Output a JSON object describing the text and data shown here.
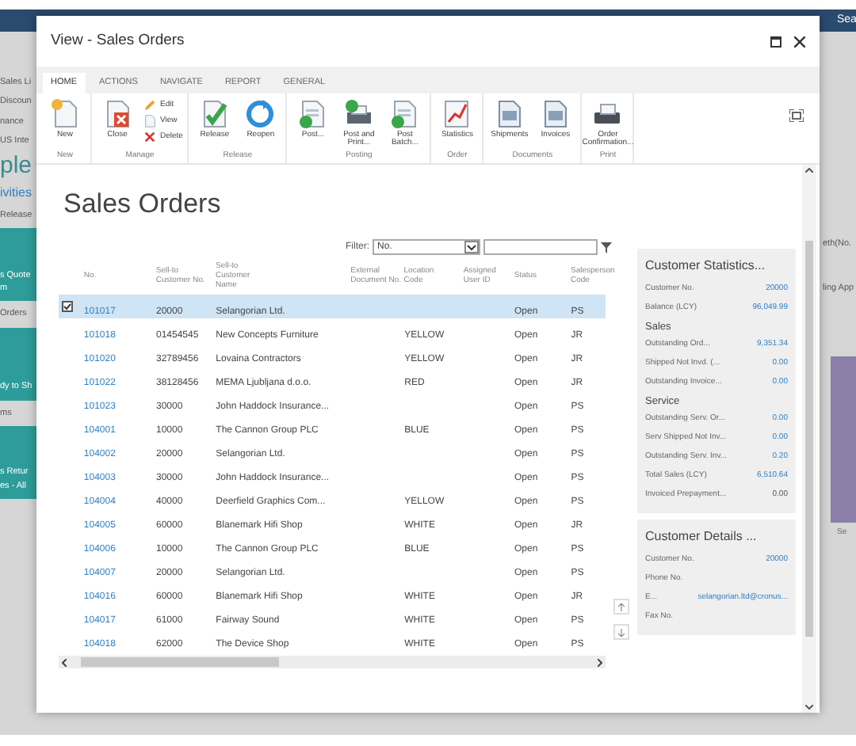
{
  "background": {
    "top_right": "Sea",
    "left": [
      {
        "kind": "label",
        "text": "Sales Li"
      },
      {
        "kind": "label",
        "text": "Discoun"
      },
      {
        "kind": "label",
        "text": "nance"
      },
      {
        "kind": "label",
        "text": "US Inte"
      },
      {
        "kind": "title",
        "text": "ple"
      },
      {
        "kind": "link",
        "text": "ivities"
      },
      {
        "kind": "label",
        "text": "Release"
      },
      {
        "kind": "tile",
        "text": "s Quote",
        "sub": "m"
      },
      {
        "kind": "label",
        "text": "Orders"
      },
      {
        "kind": "tile",
        "text": "dy to Sh"
      },
      {
        "kind": "label",
        "text": "ms"
      },
      {
        "kind": "tile",
        "text": "s Retur",
        "sub": "es - All"
      }
    ],
    "right": [
      "eth(No.",
      "ling App"
    ],
    "chart_label": "Se"
  },
  "window": {
    "title": "View - Sales Orders"
  },
  "tabs": [
    {
      "label": "HOME",
      "selected": true
    },
    {
      "label": "ACTIONS",
      "selected": false
    },
    {
      "label": "NAVIGATE",
      "selected": false
    },
    {
      "label": "REPORT",
      "selected": false
    },
    {
      "label": "GENERAL",
      "selected": false
    }
  ],
  "ribbon": [
    {
      "group": "New",
      "items": [
        {
          "label": "New",
          "kind": "new"
        }
      ]
    },
    {
      "group": "Manage",
      "items": [
        {
          "label": "Close",
          "kind": "close"
        }
      ],
      "small_items": [
        {
          "label": "Edit",
          "kind": "edit"
        },
        {
          "label": "View",
          "kind": "view"
        },
        {
          "label": "Delete",
          "kind": "delete"
        }
      ]
    },
    {
      "group": "Release",
      "items": [
        {
          "label": "Release",
          "kind": "release"
        },
        {
          "label": "Reopen",
          "kind": "reopen"
        }
      ]
    },
    {
      "group": "Posting",
      "items": [
        {
          "label": "Post...",
          "kind": "post"
        },
        {
          "label": "Post and Print...",
          "kind": "postprint"
        },
        {
          "label": "Post Batch...",
          "kind": "post"
        }
      ]
    },
    {
      "group": "Order",
      "items": [
        {
          "label": "Statistics",
          "kind": "chart"
        }
      ]
    },
    {
      "group": "Documents",
      "items": [
        {
          "label": "Shipments",
          "kind": "doc"
        },
        {
          "label": "Invoices",
          "kind": "doc"
        }
      ]
    },
    {
      "group": "Print",
      "items": [
        {
          "label": "Order Confirmation...",
          "kind": "printer"
        }
      ]
    }
  ],
  "page_title": "Sales Orders",
  "filter": {
    "label": "Filter:",
    "field": "No."
  },
  "table": {
    "columns": [
      "No.",
      "Sell-to Customer No.",
      "Sell-to Customer Name",
      "External Document No.",
      "Location Code",
      "Assigned User ID",
      "Status",
      "Salesperson Code"
    ],
    "rows": [
      {
        "selected": true,
        "cells": [
          "101017",
          "20000",
          "Selangorian Ltd.",
          "",
          "",
          "",
          "Open",
          "PS"
        ]
      },
      {
        "selected": false,
        "cells": [
          "101018",
          "01454545",
          "New Concepts Furniture",
          "",
          "YELLOW",
          "",
          "Open",
          "JR"
        ]
      },
      {
        "selected": false,
        "cells": [
          "101020",
          "32789456",
          "Lovaina Contractors",
          "",
          "YELLOW",
          "",
          "Open",
          "JR"
        ]
      },
      {
        "selected": false,
        "cells": [
          "101022",
          "38128456",
          "MEMA Ljubljana d.o.o.",
          "",
          "RED",
          "",
          "Open",
          "JR"
        ]
      },
      {
        "selected": false,
        "cells": [
          "101023",
          "30000",
          "John Haddock Insurance...",
          "",
          "",
          "",
          "Open",
          "PS"
        ]
      },
      {
        "selected": false,
        "cells": [
          "104001",
          "10000",
          "The Cannon Group PLC",
          "",
          "BLUE",
          "",
          "Open",
          "PS"
        ]
      },
      {
        "selected": false,
        "cells": [
          "104002",
          "20000",
          "Selangorian Ltd.",
          "",
          "",
          "",
          "Open",
          "PS"
        ]
      },
      {
        "selected": false,
        "cells": [
          "104003",
          "30000",
          "John Haddock Insurance...",
          "",
          "",
          "",
          "Open",
          "PS"
        ]
      },
      {
        "selected": false,
        "cells": [
          "104004",
          "40000",
          "Deerfield Graphics Com...",
          "",
          "YELLOW",
          "",
          "Open",
          "PS"
        ]
      },
      {
        "selected": false,
        "cells": [
          "104005",
          "60000",
          "Blanemark Hifi Shop",
          "",
          "WHITE",
          "",
          "Open",
          "JR"
        ]
      },
      {
        "selected": false,
        "cells": [
          "104006",
          "10000",
          "The Cannon Group PLC",
          "",
          "BLUE",
          "",
          "Open",
          "PS"
        ]
      },
      {
        "selected": false,
        "cells": [
          "104007",
          "20000",
          "Selangorian Ltd.",
          "",
          "",
          "",
          "Open",
          "PS"
        ]
      },
      {
        "selected": false,
        "cells": [
          "104016",
          "60000",
          "Blanemark Hifi Shop",
          "",
          "WHITE",
          "",
          "Open",
          "JR"
        ]
      },
      {
        "selected": false,
        "cells": [
          "104017",
          "61000",
          "Fairway Sound",
          "",
          "WHITE",
          "",
          "Open",
          "PS"
        ]
      },
      {
        "selected": false,
        "cells": [
          "104018",
          "62000",
          "The Device Shop",
          "",
          "WHITE",
          "",
          "Open",
          "PS"
        ]
      }
    ]
  },
  "factboxes": [
    {
      "title": "Customer Statistics...",
      "items": [
        {
          "kind": "field",
          "label": "Customer No.",
          "value": "20000",
          "link": true
        },
        {
          "kind": "field",
          "label": "Balance (LCY)",
          "value": "96,049.99",
          "link": true
        },
        {
          "kind": "heading",
          "label": "Sales"
        },
        {
          "kind": "field",
          "label": "Outstanding Ord...",
          "value": "9,351.34",
          "link": true
        },
        {
          "kind": "field",
          "label": "Shipped Not Invd. (...",
          "value": "0.00",
          "link": true
        },
        {
          "kind": "field",
          "label": "Outstanding Invoice...",
          "value": "0.00",
          "link": true
        },
        {
          "kind": "heading",
          "label": "Service"
        },
        {
          "kind": "field",
          "label": "Outstanding Serv. Or...",
          "value": "0.00",
          "link": true
        },
        {
          "kind": "field",
          "label": "Serv Shipped Not Inv...",
          "value": "0.00",
          "link": true
        },
        {
          "kind": "field",
          "label": "Outstanding Serv. Inv...",
          "value": "0.20",
          "link": true
        },
        {
          "kind": "field",
          "label": "Total Sales (LCY)",
          "value": "6,510.64",
          "link": true
        },
        {
          "kind": "field",
          "label": "Invoiced Prepayment...",
          "value": "0.00",
          "link": false
        }
      ]
    },
    {
      "title": "Customer Details ...",
      "items": [
        {
          "kind": "field",
          "label": "Customer No.",
          "value": "20000",
          "link": true
        },
        {
          "kind": "field",
          "label": "Phone No."
        },
        {
          "kind": "field",
          "label": "E...",
          "value": "selangorian.ltd@cronus...",
          "link": true
        },
        {
          "kind": "field",
          "label": "Fax No."
        }
      ]
    }
  ]
}
